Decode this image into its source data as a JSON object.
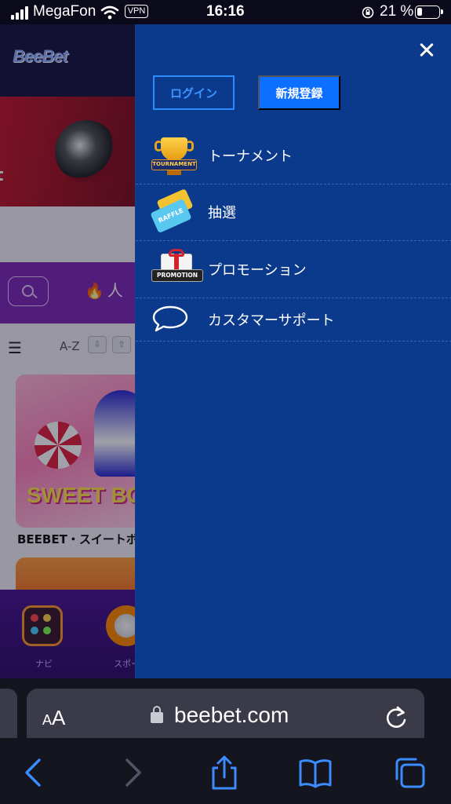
{
  "status_bar": {
    "carrier": "MegaFon",
    "vpn": "VPN",
    "time": "16:16",
    "battery": "21 %"
  },
  "background_site": {
    "logo": "BeeBet",
    "hero_fragment": "t",
    "popular_fragment": "人",
    "sort_label": "A-Z",
    "game_title": "BEEBET・スイートボ",
    "game_logo": "SWEET BO",
    "tab1_label": "ナビ",
    "tab2_label": "スポー"
  },
  "menu": {
    "login": "ログイン",
    "register": "新規登録",
    "items": [
      {
        "label": "トーナメント",
        "icon": "trophy-icon",
        "badge": "TOURNAMENT"
      },
      {
        "label": "抽選",
        "icon": "raffle-ticket-icon",
        "badge": "RAFFLE"
      },
      {
        "label": "プロモーション",
        "icon": "promotion-gift-icon",
        "badge": "PROMOTION"
      },
      {
        "label": "カスタマーサポート",
        "icon": "chat-bubble-icon"
      }
    ],
    "colors": {
      "background": "#0b3a8c",
      "accent": "#0d6fff"
    }
  },
  "safari": {
    "aa_small": "A",
    "aa_big": "A",
    "url": "beebet.com"
  }
}
